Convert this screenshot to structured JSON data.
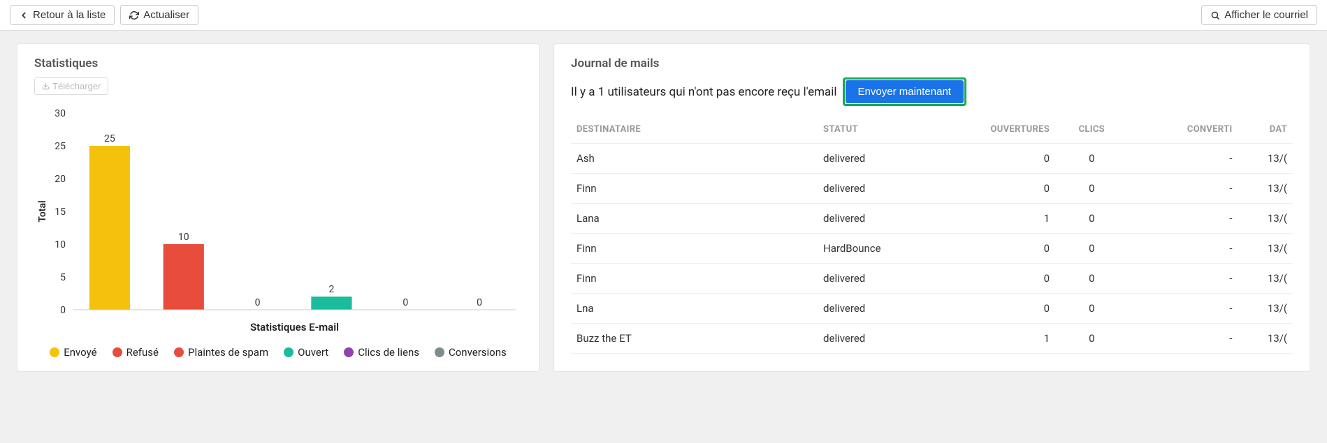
{
  "toolbar": {
    "back_label": "Retour à la liste",
    "refresh_label": "Actualiser",
    "view_email_label": "Afficher le courriel"
  },
  "stats": {
    "title": "Statistiques",
    "download_label": "Télécharger"
  },
  "chart_data": {
    "type": "bar",
    "categories": [
      "Envoyé",
      "Refusé",
      "Plaintes de spam",
      "Ouvert",
      "Clics de liens",
      "Conversions"
    ],
    "values": [
      25,
      10,
      0,
      2,
      0,
      0
    ],
    "colors": [
      "#f4c20d",
      "#e74c3c",
      "#e74c3c",
      "#1abc9c",
      "#8e44ad",
      "#7f8c8d"
    ],
    "title": "",
    "xlabel": "Statistiques E-mail",
    "ylabel": "Total",
    "ylim": [
      0,
      30
    ],
    "ystep": 5
  },
  "log": {
    "title": "Journal de mails",
    "info_prefix": "Il y a ",
    "pending_count": "1",
    "info_suffix": " utilisateurs qui n'ont pas encore reçu l'email",
    "send_now_label": "Envoyer maintenant",
    "columns": {
      "recipient": "DESTINATAIRE",
      "status": "STATUT",
      "opens": "OUVERTURES",
      "clicks": "CLICS",
      "converted": "CONVERTI",
      "date": "DAT"
    },
    "rows": [
      {
        "recipient": "Ash",
        "status": "delivered",
        "opens": "0",
        "clicks": "0",
        "converted": "-",
        "date": "13/("
      },
      {
        "recipient": "Finn",
        "status": "delivered",
        "opens": "0",
        "clicks": "0",
        "converted": "-",
        "date": "13/("
      },
      {
        "recipient": "Lana",
        "status": "delivered",
        "opens": "1",
        "clicks": "0",
        "converted": "-",
        "date": "13/("
      },
      {
        "recipient": "Finn",
        "status": "HardBounce",
        "opens": "0",
        "clicks": "0",
        "converted": "-",
        "date": "13/("
      },
      {
        "recipient": "Finn",
        "status": "delivered",
        "opens": "0",
        "clicks": "0",
        "converted": "-",
        "date": "13/("
      },
      {
        "recipient": "Lna",
        "status": "delivered",
        "opens": "0",
        "clicks": "0",
        "converted": "-",
        "date": "13/("
      },
      {
        "recipient": "Buzz the ET",
        "status": "delivered",
        "opens": "1",
        "clicks": "0",
        "converted": "-",
        "date": "13/("
      }
    ]
  }
}
